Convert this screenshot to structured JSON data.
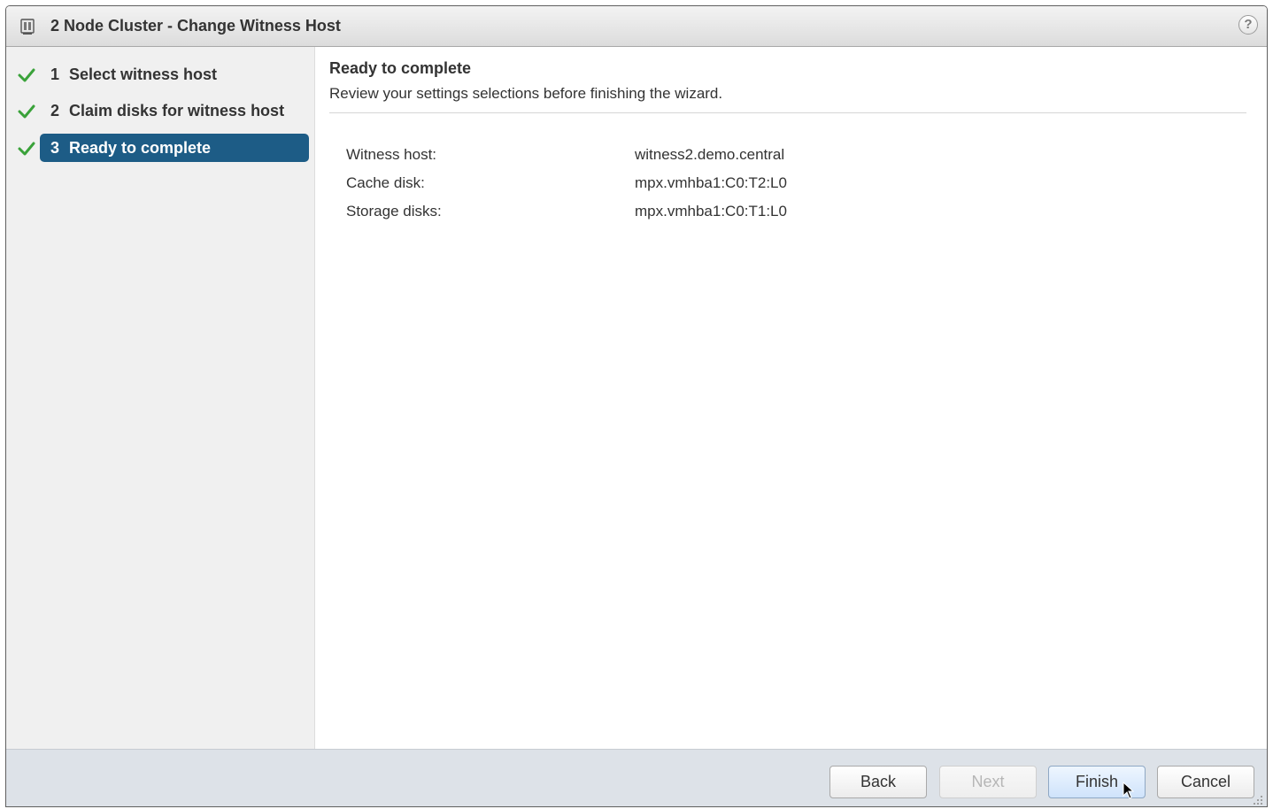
{
  "window": {
    "title": "2 Node Cluster - Change Witness Host",
    "icon": "cluster-icon",
    "help_glyph": "?"
  },
  "nav": {
    "steps": [
      {
        "number": "1",
        "label": "Select witness host",
        "completed": true,
        "active": false
      },
      {
        "number": "2",
        "label": "Claim disks for witness host",
        "completed": true,
        "active": false
      },
      {
        "number": "3",
        "label": "Ready to complete",
        "completed": true,
        "active": true
      }
    ]
  },
  "main": {
    "title": "Ready to complete",
    "subtitle": "Review your settings selections before finishing the wizard.",
    "summary": [
      {
        "key": "Witness host:",
        "value": "witness2.demo.central"
      },
      {
        "key": "Cache disk:",
        "value": "mpx.vmhba1:C0:T2:L0"
      },
      {
        "key": "Storage disks:",
        "value": "mpx.vmhba1:C0:T1:L0"
      }
    ]
  },
  "footer": {
    "back_label": "Back",
    "next_label": "Next",
    "finish_label": "Finish",
    "cancel_label": "Cancel"
  },
  "colors": {
    "active_step": "#1d5c86",
    "check": "#3aa23a",
    "footer_bg": "#dde2e8"
  }
}
